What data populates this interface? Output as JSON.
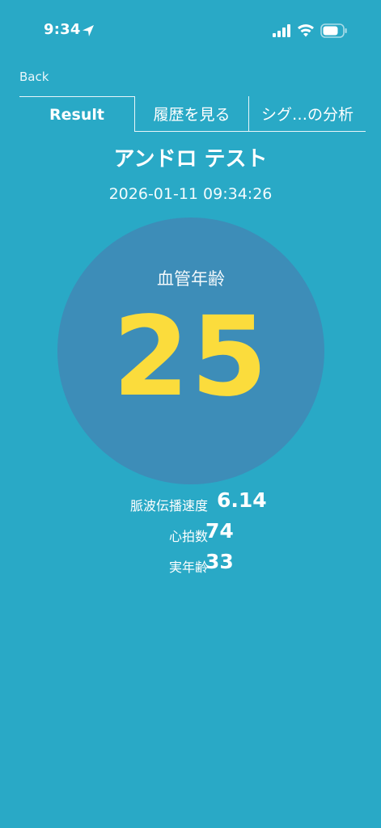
{
  "status_bar": {
    "time": "9:34",
    "icons": [
      "location-arrow-icon",
      "cellular-signal-icon",
      "wifi-icon",
      "battery-icon"
    ]
  },
  "nav": {
    "back_label": "Back"
  },
  "tabs": [
    {
      "label": "Result",
      "selected": true
    },
    {
      "label": "履歴を見る",
      "selected": false
    },
    {
      "label": "シグ…の分析",
      "selected": false
    }
  ],
  "result": {
    "title": "アンドロ テスト",
    "timestamp": "2026-01-11 09:34:26",
    "circle_label": "血管年齢",
    "vascular_age": "25"
  },
  "metrics": [
    {
      "label": "脈波伝播速度",
      "value": "6.14"
    },
    {
      "label": "心拍数",
      "value": "74"
    },
    {
      "label": "実年齢",
      "value": "33"
    }
  ],
  "colors": {
    "background": "#29a9c6",
    "circle": "#3d8db8",
    "accent_value": "#fbdc3c",
    "text": "#ffffff"
  }
}
